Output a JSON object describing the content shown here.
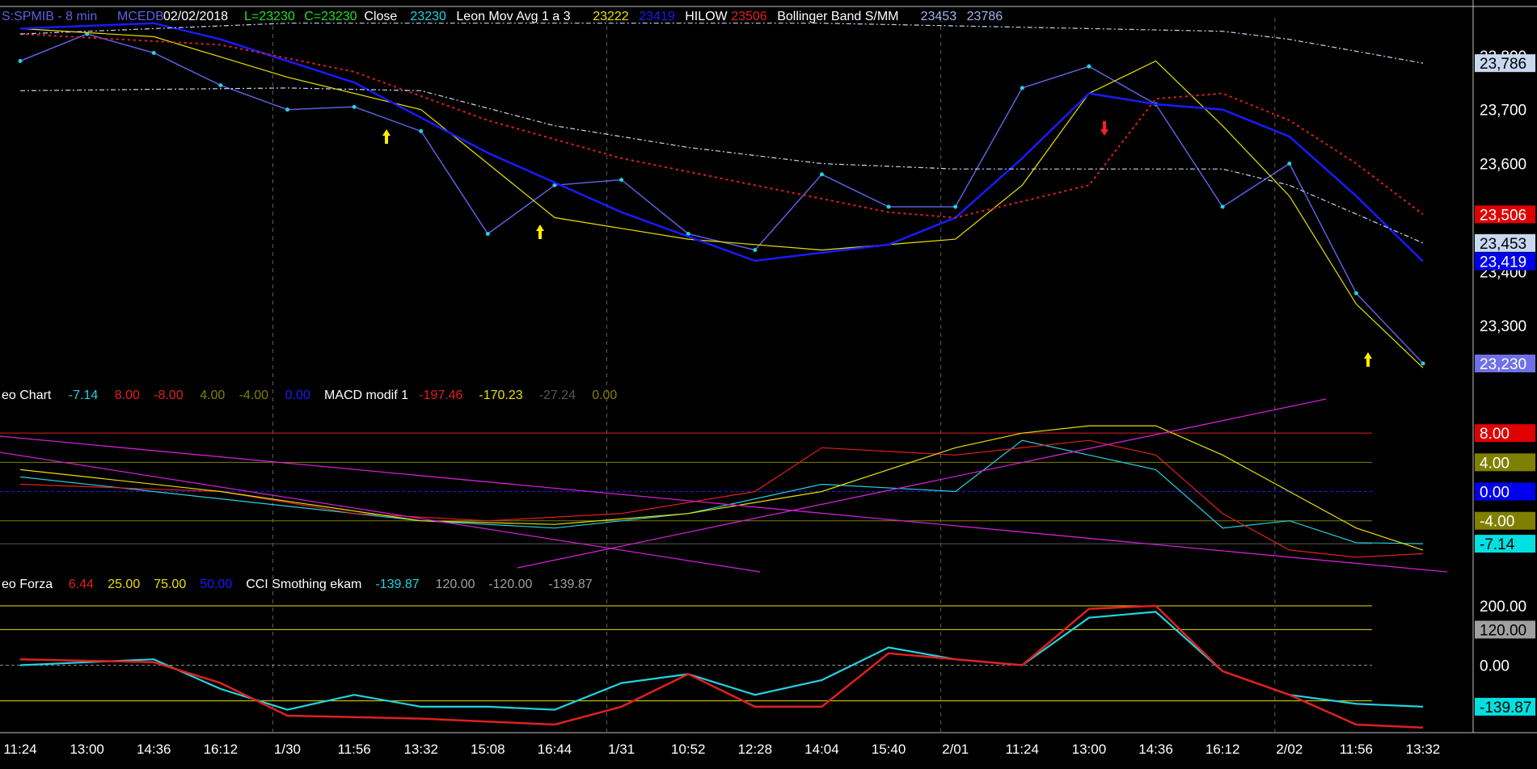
{
  "colors": {
    "background": "#000000",
    "frame": "#c0c0c0",
    "close_line": "#5f5fe0",
    "close_points": "#22d3e0",
    "leon_mov_avg": "#e8e000",
    "hilow": "#1a1aff",
    "bollinger_mid": "#e02020",
    "bollinger_band": "#c8d4f0",
    "hilow_lower": "#20e020",
    "macd_hist": "#a0a0a0",
    "macd_fast": "#22d3e0",
    "macd_slow": "#e02020",
    "macd_signal": "#e8e000",
    "trendline": "#d020d0",
    "level_red": "#e02020",
    "level_olive": "#808000",
    "level_blue": "#1a1aff",
    "cci": "#22d3e0",
    "cci_smooth": "#e02020",
    "cci_level": "#e8e000",
    "up_arrow": "#ffee00",
    "down_arrow": "#ff2020"
  },
  "headers": {
    "price": [
      {
        "text": "S:SPMIB - 8 min",
        "color": "#5f5fe0"
      },
      {
        "text": "MCEDB",
        "color": "#5f5fe0"
      },
      {
        "text": "02/02/2018",
        "color": "#ffffff"
      },
      {
        "text": "L=23230",
        "color": "#20e020"
      },
      {
        "text": "C=23230",
        "color": "#20e020"
      },
      {
        "text": "Close",
        "color": "#ffffff"
      },
      {
        "text": "23230",
        "color": "#22d3e0"
      },
      {
        "text": "Leon Mov Avg 1 a 3",
        "color": "#ffffff"
      },
      {
        "text": "23222",
        "color": "#e8e000"
      },
      {
        "text": "23419",
        "color": "#1a1aff"
      },
      {
        "text": "HILOW",
        "color": "#ffffff"
      },
      {
        "text": "23506",
        "color": "#e02020"
      },
      {
        "text": "Bollinger Band S/MM",
        "color": "#ffffff"
      },
      {
        "text": "23453",
        "color": "#a0b4e8"
      },
      {
        "text": "23786",
        "color": "#a0b4e8"
      }
    ],
    "macd": [
      {
        "text": "eo Chart",
        "color": "#ffffff"
      },
      {
        "text": "-7.14",
        "color": "#22d3e0"
      },
      {
        "text": "8.00",
        "color": "#e02020"
      },
      {
        "text": "-8.00",
        "color": "#e02020"
      },
      {
        "text": "4.00",
        "color": "#808000"
      },
      {
        "text": "-4.00",
        "color": "#808000"
      },
      {
        "text": "0.00",
        "color": "#1a1aff"
      },
      {
        "text": "MACD modif 1",
        "color": "#ffffff"
      },
      {
        "text": "-197.46",
        "color": "#e02020"
      },
      {
        "text": "-170.23",
        "color": "#e8e000"
      },
      {
        "text": "-27.24",
        "color": "#555555"
      },
      {
        "text": "0.00",
        "color": "#808000"
      }
    ],
    "cci": [
      {
        "text": "eo Forza",
        "color": "#ffffff"
      },
      {
        "text": "6.44",
        "color": "#e02020"
      },
      {
        "text": "25.00",
        "color": "#e8e000"
      },
      {
        "text": "75.00",
        "color": "#e8e000"
      },
      {
        "text": "50.00",
        "color": "#1a1aff"
      },
      {
        "text": "CCI Smothing ekam",
        "color": "#ffffff"
      },
      {
        "text": "-139.87",
        "color": "#22d3e0"
      },
      {
        "text": "120.00",
        "color": "#a0a0a0"
      },
      {
        "text": "-120.00",
        "color": "#a0a0a0"
      },
      {
        "text": "-139.87",
        "color": "#a0a0a0"
      }
    ]
  },
  "x_axis": {
    "labels": [
      "11:24",
      "13:00",
      "14:36",
      "16:12",
      "1/30",
      "11:56",
      "13:32",
      "15:08",
      "16:44",
      "1/31",
      "10:52",
      "12:28",
      "14:04",
      "15:40",
      "2/01",
      "11:24",
      "13:00",
      "14:36",
      "16:12",
      "2/02",
      "11:56",
      "13:32"
    ]
  },
  "chart_data": [
    {
      "type": "line",
      "panel": "price",
      "ylim": [
        23200,
        23870
      ],
      "y_ticks": [
        23300,
        23400,
        23600,
        23700,
        23800
      ],
      "y_tick_labels": [
        "23,300",
        "23,400",
        "23,600",
        "23,700",
        "23,800"
      ],
      "value_badges": [
        {
          "value": 23786,
          "label": "23,786",
          "bg": "#c8d8f0",
          "fg": "#000000"
        },
        {
          "value": 23506,
          "label": "23,506",
          "bg": "#e00000",
          "fg": "#ffffff"
        },
        {
          "value": 23453,
          "label": "23,453",
          "bg": "#c8d8f0",
          "fg": "#000000"
        },
        {
          "value": 23419,
          "label": "23,419",
          "bg": "#0000ee",
          "fg": "#ffffff"
        },
        {
          "value": 23230,
          "label": "23,230",
          "bg": "#7070e8",
          "fg": "#ffffff"
        }
      ],
      "series": [
        {
          "name": "Close",
          "x": [
            0,
            1,
            2,
            3,
            4,
            5,
            6,
            7,
            8,
            9,
            10,
            11,
            12,
            13,
            14,
            15,
            16,
            17,
            18,
            19,
            20,
            21
          ],
          "y": [
            23790,
            23840,
            23805,
            23745,
            23700,
            23705,
            23660,
            23470,
            23560,
            23570,
            23470,
            23440,
            23580,
            23520,
            23520,
            23740,
            23780,
            23710,
            23520,
            23600,
            23360,
            23230
          ]
        },
        {
          "name": "",
          "x": [
            0,
            2,
            4,
            6,
            8,
            10,
            12,
            14,
            15,
            16,
            17,
            18,
            19,
            20,
            21
          ],
          "y": [
            23850,
            23835,
            23760,
            23700,
            23500,
            23460,
            23440,
            23460,
            23560,
            23730,
            23790,
            23670,
            23540,
            23340,
            23222
          ]
        },
        {
          "name": "",
          "x": [
            0,
            2,
            3,
            5,
            7,
            9,
            11,
            13,
            14,
            15,
            16,
            17,
            18,
            19,
            20,
            21
          ],
          "y": [
            23850,
            23860,
            23830,
            23750,
            23620,
            23510,
            23420,
            23450,
            23500,
            23610,
            23730,
            23710,
            23700,
            23650,
            23540,
            23419
          ]
        },
        {
          "name": "",
          "x": [
            0,
            3,
            5,
            7,
            9,
            11,
            13,
            14,
            16,
            17,
            18,
            19,
            20,
            21
          ],
          "y": [
            23840,
            23820,
            23770,
            23680,
            23610,
            23560,
            23510,
            23500,
            23560,
            23720,
            23730,
            23680,
            23600,
            23506
          ]
        },
        {
          "name": "",
          "x": [
            0,
            4,
            6,
            8,
            10,
            12,
            14,
            16,
            18,
            19,
            21
          ],
          "y": [
            23735,
            23740,
            23735,
            23670,
            23630,
            23600,
            23590,
            23590,
            23590,
            23560,
            23453
          ]
        },
        {
          "name": "",
          "x": [
            0,
            4,
            8,
            12,
            16,
            18,
            19,
            21
          ],
          "y": [
            23840,
            23860,
            23860,
            23860,
            23850,
            23845,
            23830,
            23786
          ]
        }
      ]
    },
    {
      "type": "line",
      "panel": "macd",
      "ylim": [
        -11,
        12
      ],
      "y_ticks": [
        8,
        4,
        0,
        -4,
        -7.14
      ],
      "value_badges": [
        {
          "value": 8,
          "label": "8.00",
          "bg": "#e00000",
          "fg": "#ffffff"
        },
        {
          "value": 4,
          "label": "4.00",
          "bg": "#808000",
          "fg": "#ffffff"
        },
        {
          "value": 0,
          "label": "0.00",
          "bg": "#0000ee",
          "fg": "#ffffff"
        },
        {
          "value": -4,
          "label": "-4.00",
          "bg": "#808000",
          "fg": "#ffffff"
        },
        {
          "value": -7.14,
          "label": "-7.14",
          "bg": "#00e0e0",
          "fg": "#000000"
        }
      ],
      "series": [
        {
          "name": "",
          "x": [
            0,
            2,
            4,
            6,
            8,
            10,
            12,
            14,
            15,
            16,
            17,
            18,
            19,
            20,
            21
          ],
          "y": [
            2,
            0,
            -2,
            -4,
            -5,
            -3,
            1,
            0,
            7,
            5,
            3,
            -5,
            -4,
            -7,
            -7.14
          ]
        },
        {
          "name": "",
          "x": [
            0,
            3,
            5,
            7,
            9,
            11,
            12,
            14,
            16,
            17,
            18,
            19,
            20,
            21
          ],
          "y": [
            1,
            0,
            -3,
            -4,
            -3,
            0,
            6,
            5,
            7,
            5,
            -3,
            -8,
            -9,
            -8.5
          ]
        },
        {
          "name": "",
          "x": [
            0,
            3,
            6,
            8,
            10,
            12,
            14,
            15,
            16,
            17,
            18,
            19,
            20,
            21
          ],
          "y": [
            3,
            0,
            -4,
            -4.5,
            -3,
            0,
            6,
            8,
            9,
            9,
            5,
            0,
            -5,
            -8
          ]
        }
      ]
    },
    {
      "type": "line",
      "panel": "cci",
      "ylim": [
        -230,
        260
      ],
      "y_ticks": [
        200,
        120,
        0,
        -120
      ],
      "value_badges": [
        {
          "value": 200,
          "label": "200.00",
          "bg": "#000000",
          "fg": "#ffffff"
        },
        {
          "value": 120,
          "label": "120.00",
          "bg": "#a0a0a0",
          "fg": "#000000"
        },
        {
          "value": 0,
          "label": "0.00",
          "bg": "#000000",
          "fg": "#ffffff"
        },
        {
          "value": -139.87,
          "label": "-139.87",
          "bg": "#00e0e0",
          "fg": "#000000"
        }
      ],
      "series": [
        {
          "name": "",
          "x": [
            0,
            1,
            2,
            3,
            4,
            5,
            6,
            7,
            8,
            9,
            10,
            11,
            12,
            13,
            14,
            15,
            16,
            17,
            18,
            19,
            20,
            21
          ],
          "y": [
            0,
            10,
            20,
            -80,
            -150,
            -100,
            -140,
            -140,
            -150,
            -60,
            -30,
            -100,
            -50,
            60,
            20,
            0,
            160,
            180,
            -20,
            -100,
            -130,
            -139.87
          ]
        },
        {
          "name": "",
          "x": [
            0,
            2,
            3,
            4,
            6,
            8,
            9,
            10,
            11,
            12,
            13,
            15,
            16,
            17,
            18,
            19,
            20,
            21
          ],
          "y": [
            20,
            10,
            -60,
            -170,
            -180,
            -200,
            -140,
            -30,
            -140,
            -140,
            40,
            0,
            190,
            200,
            -20,
            -100,
            -200,
            -210
          ]
        }
      ]
    }
  ]
}
